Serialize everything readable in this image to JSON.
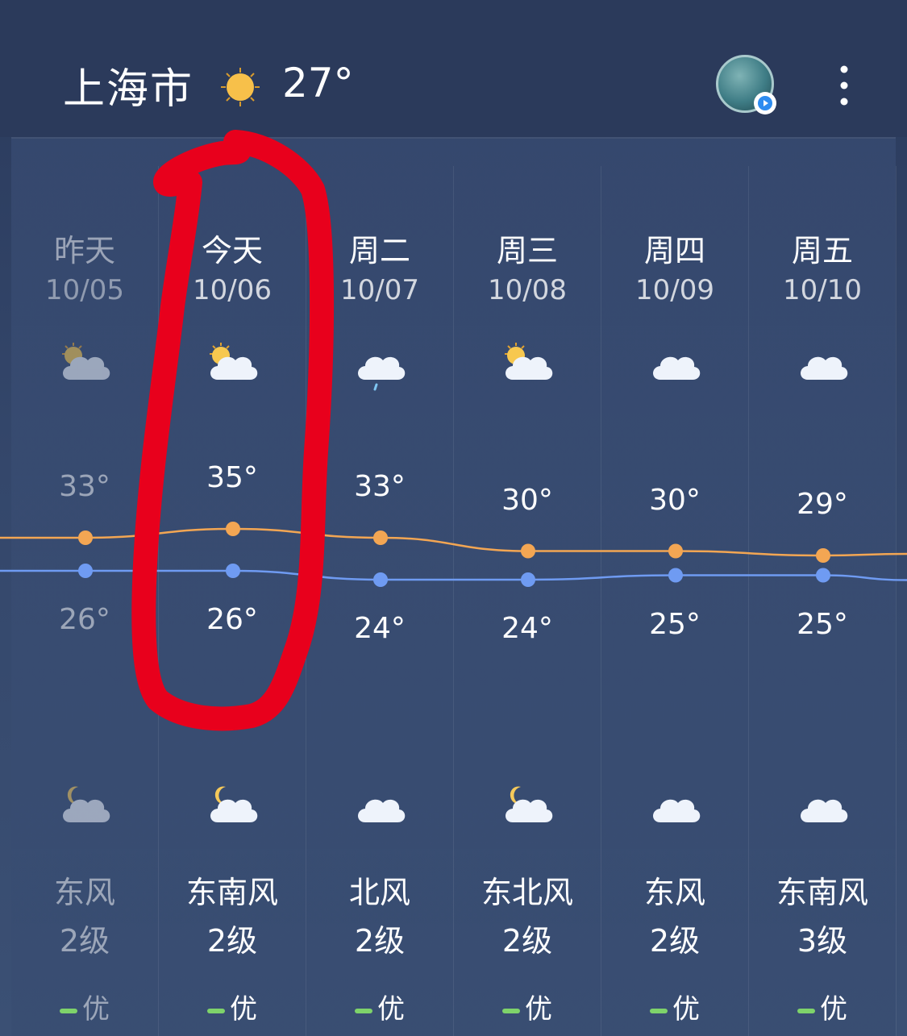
{
  "header": {
    "city": "上海市",
    "current_temp": "27°",
    "weather_icon": "sun-icon",
    "avatar_icon": "forest-avatar",
    "menu_icon": "more-vertical-icon"
  },
  "colors": {
    "high_line": "#f3a653",
    "low_line": "#6f9bf2",
    "aq_good": "#7ed36a",
    "annotation": "#e8001c"
  },
  "forecast": [
    {
      "day": "昨天",
      "date": "10/05",
      "high": "33°",
      "low": "26°",
      "high_value": 33,
      "low_value": 26,
      "day_icon": "partly-cloudy-icon",
      "night_icon": "cloudy-night-icon",
      "wind": "东风",
      "level": "2级",
      "aq": "优",
      "past": true
    },
    {
      "day": "今天",
      "date": "10/06",
      "high": "35°",
      "low": "26°",
      "high_value": 35,
      "low_value": 26,
      "day_icon": "partly-cloudy-icon",
      "night_icon": "cloudy-night-icon",
      "wind": "东南风",
      "level": "2级",
      "aq": "优",
      "past": false
    },
    {
      "day": "周二",
      "date": "10/07",
      "high": "33°",
      "low": "24°",
      "high_value": 33,
      "low_value": 24,
      "day_icon": "light-rain-icon",
      "night_icon": "cloud-icon",
      "wind": "北风",
      "level": "2级",
      "aq": "优",
      "past": false
    },
    {
      "day": "周三",
      "date": "10/08",
      "high": "30°",
      "low": "24°",
      "high_value": 30,
      "low_value": 24,
      "day_icon": "partly-cloudy-icon",
      "night_icon": "cloudy-night-icon",
      "wind": "东北风",
      "level": "2级",
      "aq": "优",
      "past": false
    },
    {
      "day": "周四",
      "date": "10/09",
      "high": "30°",
      "low": "25°",
      "high_value": 30,
      "low_value": 25,
      "day_icon": "cloud-icon",
      "night_icon": "cloud-icon",
      "wind": "东风",
      "level": "2级",
      "aq": "优",
      "past": false
    },
    {
      "day": "周五",
      "date": "10/10",
      "high": "29°",
      "low": "25°",
      "high_value": 29,
      "low_value": 25,
      "day_icon": "cloud-icon",
      "night_icon": "cloud-icon",
      "wind": "东南风",
      "level": "3级",
      "aq": "优",
      "past": false
    }
  ],
  "annotation": "hand-drawn-red-circle-around-today"
}
